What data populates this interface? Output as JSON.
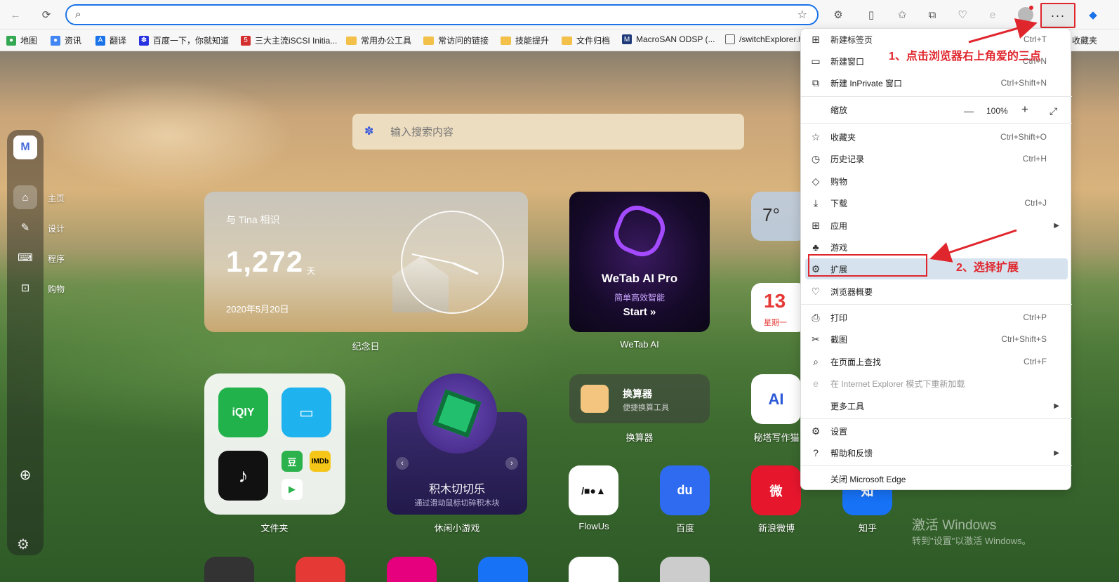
{
  "toolbar": {
    "address_value": "",
    "more_label": "···"
  },
  "bookmarks": [
    {
      "label": "地图",
      "icon": "maps-icon",
      "color": "#34a853"
    },
    {
      "label": "资讯",
      "icon": "news-icon",
      "color": "#4285f4"
    },
    {
      "label": "翻译",
      "icon": "translate-icon",
      "color": "#1a73e8"
    },
    {
      "label": "百度一下，你就知道",
      "icon": "baidu-icon",
      "color": "#2932e1"
    },
    {
      "label": "三大主流iSCSI Initia...",
      "icon": "51cto-icon",
      "color": "#d32f2f"
    },
    {
      "label": "常用办公工具",
      "icon": "folder-icon"
    },
    {
      "label": "常访问的链接",
      "icon": "folder-icon"
    },
    {
      "label": "技能提升",
      "icon": "folder-icon"
    },
    {
      "label": "文件归档",
      "icon": "folder-icon"
    },
    {
      "label": "MacroSAN ODSP (...",
      "icon": "macrosan-icon",
      "color": "#1e3a78"
    },
    {
      "label": "/switchExplorer.ht",
      "icon": "page-icon"
    },
    {
      "label": "收藏夹",
      "icon": "folder-icon"
    }
  ],
  "sidebar": {
    "items": [
      {
        "label": "主页",
        "icon": "home-icon"
      },
      {
        "label": "设计",
        "icon": "design-icon"
      },
      {
        "label": "程序",
        "icon": "program-icon"
      },
      {
        "label": "购物",
        "icon": "shopping-icon"
      }
    ]
  },
  "search": {
    "placeholder": "输入搜索内容"
  },
  "widgets": {
    "anniversary": {
      "with": "与 Tina 相识",
      "days": "1,272",
      "unit": "天",
      "date": "2020年5月20日",
      "caption": "纪念日"
    },
    "wetab": {
      "title": "WeTab AI Pro",
      "subtitle": "简单高效智能",
      "start": "Start »",
      "caption": "WeTab AI"
    },
    "weather": {
      "temp": "7°"
    },
    "calendar": {
      "day": "13",
      "weekday": "星期一"
    },
    "folder": {
      "caption": "文件夹"
    },
    "game": {
      "name": "积木切切乐",
      "desc": "通过滑动鼠标切碎积木块",
      "caption": "休闲小游戏"
    },
    "calculator": {
      "title": "换算器",
      "desc": "便捷换算工具",
      "caption": "换算器"
    },
    "metaso": {
      "caption": "秘塔写作猫"
    },
    "tiles": [
      {
        "caption": "FlowUs",
        "color": "#ffffff",
        "fg": "#111111",
        "glyph": "/■●▲"
      },
      {
        "caption": "百度",
        "color": "#2e6bf0",
        "fg": "#ffffff",
        "glyph": "du"
      },
      {
        "caption": "新浪微博",
        "color": "#e6162d",
        "fg": "#ffffff",
        "glyph": "微"
      },
      {
        "caption": "知乎",
        "color": "#1772f6",
        "fg": "#ffffff",
        "glyph": "知"
      }
    ]
  },
  "watermark": {
    "line1": "激活 Windows",
    "line2": "转到\"设置\"以激活 Windows。"
  },
  "menu": {
    "items": [
      {
        "label": "新建标签页",
        "shortcut": "Ctrl+T",
        "icon": "new-tab-icon"
      },
      {
        "label": "新建窗口",
        "shortcut": "Ctrl+N",
        "icon": "new-window-icon"
      },
      {
        "label": "新建 InPrivate 窗口",
        "shortcut": "Ctrl+Shift+N",
        "icon": "inprivate-icon"
      },
      {
        "label": "缩放",
        "shortcut": "",
        "icon": ""
      },
      {
        "label": "收藏夹",
        "shortcut": "Ctrl+Shift+O",
        "icon": "favorites-icon"
      },
      {
        "label": "历史记录",
        "shortcut": "Ctrl+H",
        "icon": "history-icon"
      },
      {
        "label": "购物",
        "shortcut": "",
        "icon": "shopping-tag-icon"
      },
      {
        "label": "下载",
        "shortcut": "Ctrl+J",
        "icon": "download-icon"
      },
      {
        "label": "应用",
        "shortcut": "",
        "icon": "apps-icon"
      },
      {
        "label": "游戏",
        "shortcut": "",
        "icon": "games-icon"
      },
      {
        "label": "扩展",
        "shortcut": "",
        "icon": "extensions-icon"
      },
      {
        "label": "浏览器概要",
        "shortcut": "",
        "icon": "browser-essentials-icon"
      },
      {
        "label": "打印",
        "shortcut": "Ctrl+P",
        "icon": "print-icon"
      },
      {
        "label": "截图",
        "shortcut": "Ctrl+Shift+S",
        "icon": "screenshot-icon"
      },
      {
        "label": "在页面上查找",
        "shortcut": "Ctrl+F",
        "icon": "find-icon"
      },
      {
        "label": "在 Internet Explorer 模式下重新加载",
        "shortcut": "",
        "icon": "ie-mode-icon"
      },
      {
        "label": "更多工具",
        "shortcut": "",
        "icon": ""
      },
      {
        "label": "设置",
        "shortcut": "",
        "icon": "settings-icon"
      },
      {
        "label": "帮助和反馈",
        "shortcut": "",
        "icon": "help-icon"
      },
      {
        "label": "关闭 Microsoft Edge",
        "shortcut": "",
        "icon": ""
      }
    ],
    "zoom": {
      "minus": "—",
      "value": "100%",
      "plus": "+"
    }
  },
  "annotations": {
    "step1": "1、点击浏览器右上角爱的三点",
    "step2": "2、选择扩展"
  },
  "colors": {
    "annotation": "#e0262d",
    "address_border": "#1a73e8",
    "highlight": "#d6e3ee"
  }
}
